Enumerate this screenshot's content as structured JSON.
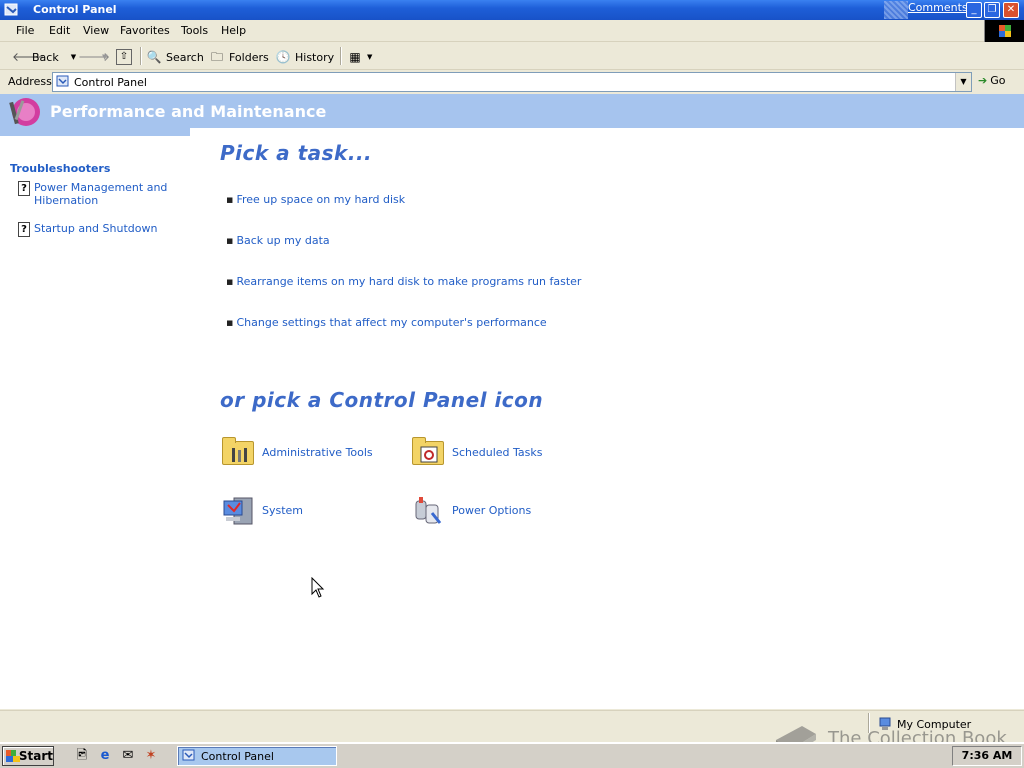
{
  "window": {
    "title": "Control Panel",
    "comments_link": "Comments?",
    "min_glyph": "_",
    "max_glyph": "❐",
    "close_glyph": "✕"
  },
  "menubar": {
    "items": [
      "File",
      "Edit",
      "View",
      "Favorites",
      "Tools",
      "Help"
    ]
  },
  "toolbar": {
    "back_label": "Back",
    "search_label": "Search",
    "folders_label": "Folders",
    "history_label": "History"
  },
  "address": {
    "label": "Address",
    "value": "Control Panel",
    "go_label": "Go"
  },
  "category": {
    "title": "Performance and Maintenance"
  },
  "sidebar": {
    "title": "Troubleshooters",
    "items": [
      {
        "label": "Power Management and Hibernation",
        "icon": "help-icon"
      },
      {
        "label": "Startup and Shutdown",
        "icon": "help-icon"
      }
    ]
  },
  "main": {
    "task_heading": "Pick a task...",
    "tasks": [
      "Free up space on my hard disk",
      "Back up my data",
      "Rearrange items on my hard disk to make programs run faster",
      "Change settings that affect my computer's performance"
    ],
    "icon_heading": "or pick a Control Panel icon",
    "icons": [
      {
        "label": "Administrative Tools",
        "icon": "admin-tools-icon"
      },
      {
        "label": "Scheduled Tasks",
        "icon": "scheduled-tasks-icon"
      },
      {
        "label": "System",
        "icon": "system-icon"
      },
      {
        "label": "Power Options",
        "icon": "power-options-icon"
      }
    ]
  },
  "statusbar": {
    "zone": "My Computer"
  },
  "taskbar": {
    "start_label": "Start",
    "window_button": "Control Panel",
    "clock": "7:36 AM"
  },
  "watermark": {
    "text": "The Collection Book"
  },
  "colors": {
    "title_blue": "#1e5fd8",
    "header_band": "#a6c4ee",
    "link_blue": "#215dc6",
    "heading_blue": "#3d6ac8"
  }
}
